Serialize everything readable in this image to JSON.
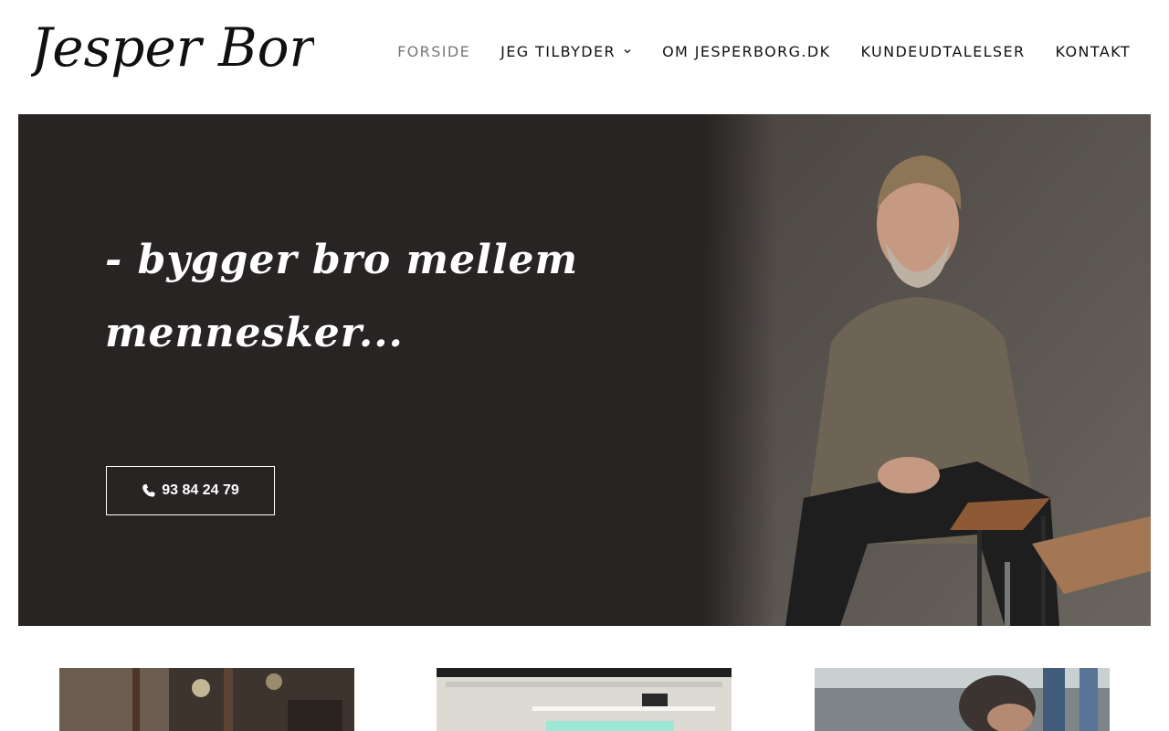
{
  "header": {
    "logo_text": "Jesper Borg",
    "nav": [
      {
        "label": "FORSIDE",
        "active": true
      },
      {
        "label": "JEG TILBYDER",
        "has_dropdown": true
      },
      {
        "label": "OM JESPERBORG.DK"
      },
      {
        "label": "KUNDEUDTALELSER"
      },
      {
        "label": "KONTAKT"
      }
    ]
  },
  "hero": {
    "tagline_line1": "- bygger bro mellem",
    "tagline_line2": "mennesker...",
    "phone_label": "93 84 24 79",
    "phone_icon": "phone-icon",
    "background_color": "#282423"
  },
  "cards": [
    {
      "name": "card-image-1"
    },
    {
      "name": "card-image-2"
    },
    {
      "name": "card-image-3"
    }
  ]
}
